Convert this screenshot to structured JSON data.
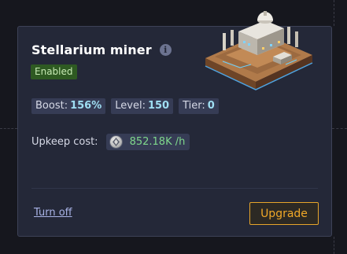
{
  "card": {
    "title": "Stellarium miner",
    "status_badge": "Enabled",
    "stats": [
      {
        "label": "Boost:",
        "value": "156%"
      },
      {
        "label": "Level:",
        "value": "150"
      },
      {
        "label": "Tier:",
        "value": "0"
      }
    ],
    "upkeep": {
      "label": "Upkeep cost:",
      "value": "852.18K /h"
    },
    "actions": {
      "turn_off": "Turn off",
      "upgrade": "Upgrade"
    }
  },
  "icons": {
    "info": "info-icon",
    "coin": "stellarium-coin-icon",
    "building": "stellarium-miner-building-image"
  },
  "colors": {
    "card_bg": "#242838",
    "accent_upgrade": "#e7a52a",
    "enabled_badge_bg": "#2e5a22",
    "stat_value": "#9fdff3",
    "upkeep_value": "#7fd88c"
  }
}
